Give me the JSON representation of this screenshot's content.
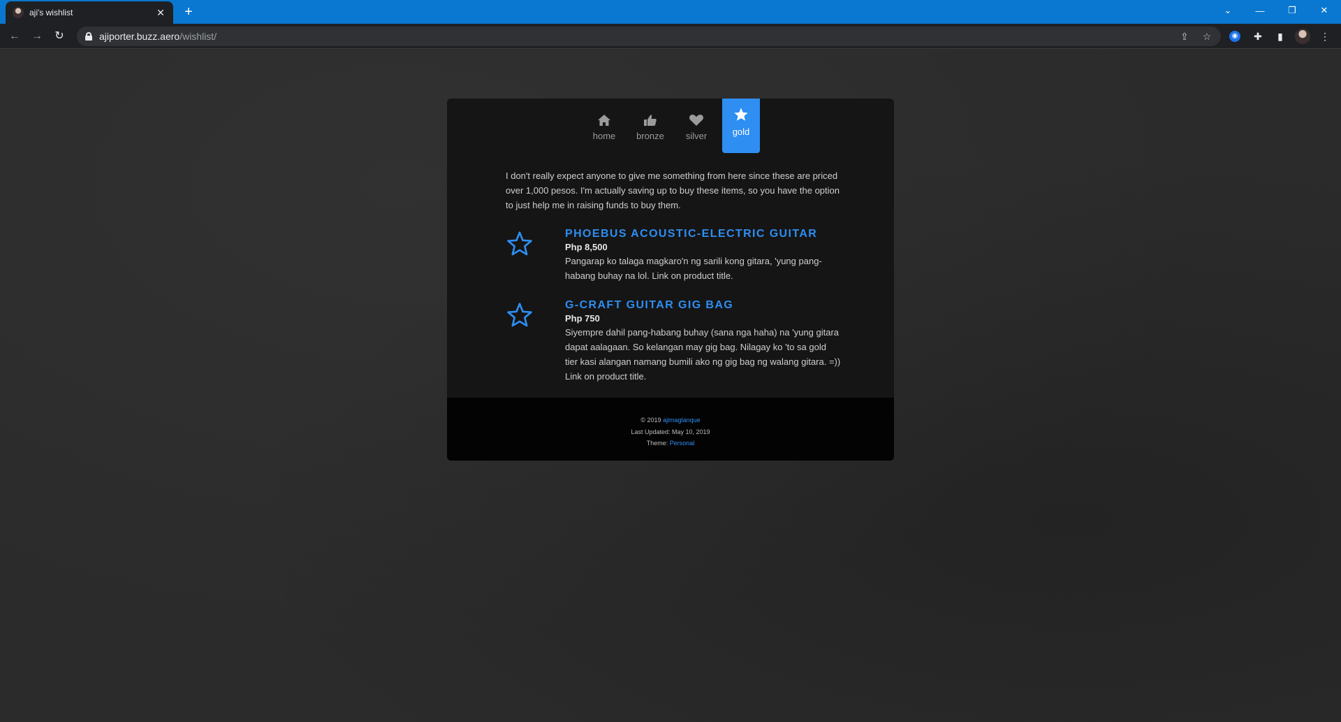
{
  "browser": {
    "tab_title": "aji's wishlist",
    "tab_close": "✕",
    "new_tab": "+",
    "url_host": "ajiporter.buzz.aero",
    "url_path": "/wishlist/"
  },
  "nav": {
    "items": [
      {
        "label": "home",
        "icon": "home-icon"
      },
      {
        "label": "bronze",
        "icon": "thumbs-up-icon"
      },
      {
        "label": "silver",
        "icon": "heart-icon"
      },
      {
        "label": "gold",
        "icon": "star-icon",
        "active": true
      }
    ]
  },
  "intro": "I don't really expect anyone to give me something from here since these are priced over 1,000 pesos. I'm actually saving up to buy these items, so you have the option to just help me in raising funds to buy them.",
  "items": [
    {
      "name": "Phoebus Acoustic-Electric Guitar",
      "price": "Php 8,500",
      "description": "Pangarap ko talaga magkaro'n ng sarili kong gitara, 'yung pang-habang buhay na lol. Link on product title."
    },
    {
      "name": "G-Craft Guitar Gig Bag",
      "price": "Php 750",
      "description": "Siyempre dahil pang-habang buhay (sana nga haha) na 'yung gitara dapat aalagaan. So kelangan may gig bag. Nilagay ko 'to sa gold tier kasi alangan namang bumili ako ng gig bag ng walang gitara. =)) Link on product title."
    }
  ],
  "footer": {
    "copyright_prefix": "© 2019",
    "author": "ajimaglanque",
    "last_updated": "Last Updated: May 10, 2019",
    "theme_prefix": "Theme:",
    "theme_name": "Personal"
  },
  "colors": {
    "accent": "#2e8ef2",
    "tabbar": "#0a78d1"
  }
}
